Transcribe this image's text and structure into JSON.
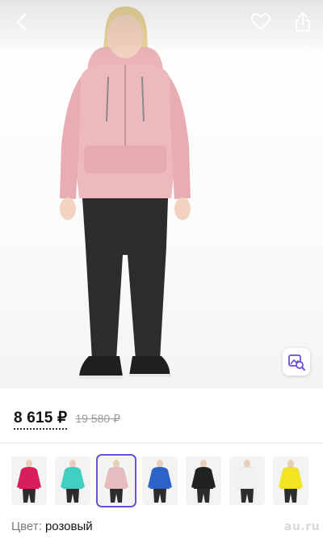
{
  "product": {
    "price_current": "8 615 ₽",
    "price_old": "19 580 ₽",
    "color_label": "Цвет:",
    "color_value": "розовый"
  },
  "header": {
    "back_icon": "chevron-left-icon",
    "favorite_icon": "heart-outline-icon",
    "share_icon": "share-icon"
  },
  "photo_action_icon": "image-search-icon",
  "swatches": [
    {
      "name": "pink-red",
      "color": "#d81f5b",
      "selected": false
    },
    {
      "name": "mint",
      "color": "#3fd0c3",
      "selected": false
    },
    {
      "name": "light-pink",
      "color": "#e7bcbe",
      "selected": true
    },
    {
      "name": "blue-ski",
      "color": "#2b63c9",
      "selected": false
    },
    {
      "name": "black",
      "color": "#222222",
      "selected": false
    },
    {
      "name": "white",
      "color": "#f2f2f2",
      "selected": false
    },
    {
      "name": "yellow",
      "color": "#f2e323",
      "selected": false
    }
  ],
  "watermark": "au.ru",
  "colors": {
    "accent": "#6b4ed8",
    "jacket": "#eeb9bd",
    "pants": "#2c2c2e"
  }
}
